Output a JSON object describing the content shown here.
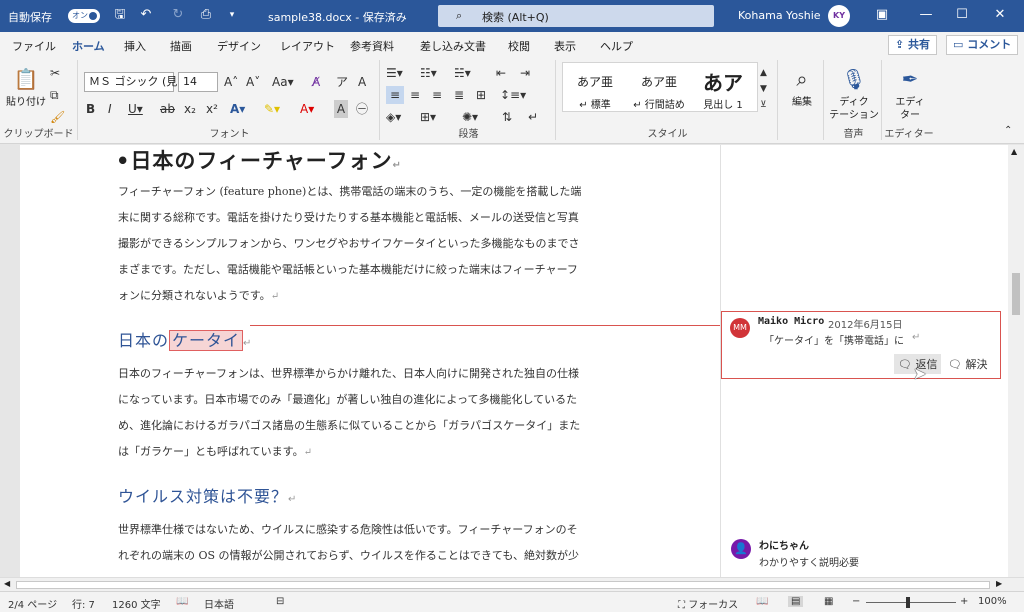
{
  "titlebar": {
    "autosave_label": "自動保存",
    "autosave_state": "オン",
    "filename": "sample38.docx - 保存済み",
    "search_placeholder": "検索 (Alt+Q)",
    "user_name": "Kohama Yoshie",
    "avatar_text": "KY",
    "minimize": "—",
    "restore": "☐",
    "close": "✕"
  },
  "tabs": [
    "ファイル",
    "ホーム",
    "挿入",
    "描画",
    "デザイン",
    "レイアウト",
    "参考資料",
    "差し込み文書",
    "校閲",
    "表示",
    "ヘルプ"
  ],
  "share_label": "共有",
  "comment_label": "コメント",
  "ribbon": {
    "clipboard": {
      "paste": "貼り付け",
      "group": "クリップボード"
    },
    "font": {
      "name": "ＭＳ ゴシック (見出",
      "size": "14",
      "group": "フォント"
    },
    "paragraph": {
      "group": "段落"
    },
    "styles": {
      "items": [
        {
          "sample": "あア亜",
          "label": "↵ 標準"
        },
        {
          "sample": "あア亜",
          "label": "↵ 行間詰め"
        },
        {
          "sample": "あア",
          "label": "見出し 1"
        }
      ],
      "group": "スタイル"
    },
    "edit": {
      "label": "編集"
    },
    "voice": {
      "label": "ディク\nテーション",
      "group": "音声"
    },
    "editor": {
      "label": "エディ\nター",
      "group": "エディター"
    }
  },
  "document": {
    "h1": "日本のフィーチャーフォン",
    "p1": [
      "フィーチャーフォン (feature phone)とは、携帯電話の端末のうち、一定の機能を搭載した端",
      "末に関する総称です。電話を掛けたり受けたりする基本機能と電話帳、メールの送受信と写真",
      "撮影ができるシンプルフォンから、ワンセグやおサイフケータイといった多機能なものまでさ",
      "まざまです。ただし、電話機能や電話帳といった基本機能だけに絞った端末はフィーチャーフ",
      "ォンに分類されないようです。"
    ],
    "h2a_prefix": "日本の",
    "h2a_highlight": "ケータイ",
    "p2": [
      "日本のフィーチャーフォンは、世界標準からかけ離れた、日本人向けに開発された独自の仕様",
      "になっています。日本市場でのみ「最適化」が著しい独自の進化によって多機能化しているた",
      "め、進化論におけるガラパゴス諸島の生態系に似ていることから「ガラパゴスケータイ」また",
      "は「ガラケー」とも呼ばれています。"
    ],
    "h2b": "ウイルス対策は不要？",
    "p3": [
      "世界標準仕様ではないため、ウイルスに感染する危険性は低いです。フィーチャーフォンのそ",
      "れぞれの端末の OS の情報が公開されておらず、ウイルスを作ることはできても、絶対数が少"
    ]
  },
  "comments": [
    {
      "initials": "MM",
      "author": "Maiko Micro",
      "date": "2012年6月15日",
      "text": "「ケータイ」を「携帯電話」に",
      "reply": "返信",
      "resolve": "解決",
      "color": "#d13438"
    },
    {
      "initials": "",
      "author": "わにちゃん",
      "text": "わかりやすく説明必要",
      "color": "#7719aa"
    }
  ],
  "status": {
    "page": "2/4 ページ",
    "line": "行: 7",
    "words": "1260 文字",
    "language": "日本語",
    "focus": "フォーカス",
    "zoom": "100%"
  },
  "colors": {
    "accent": "#2b579a",
    "comment_border": "#d9534f"
  }
}
